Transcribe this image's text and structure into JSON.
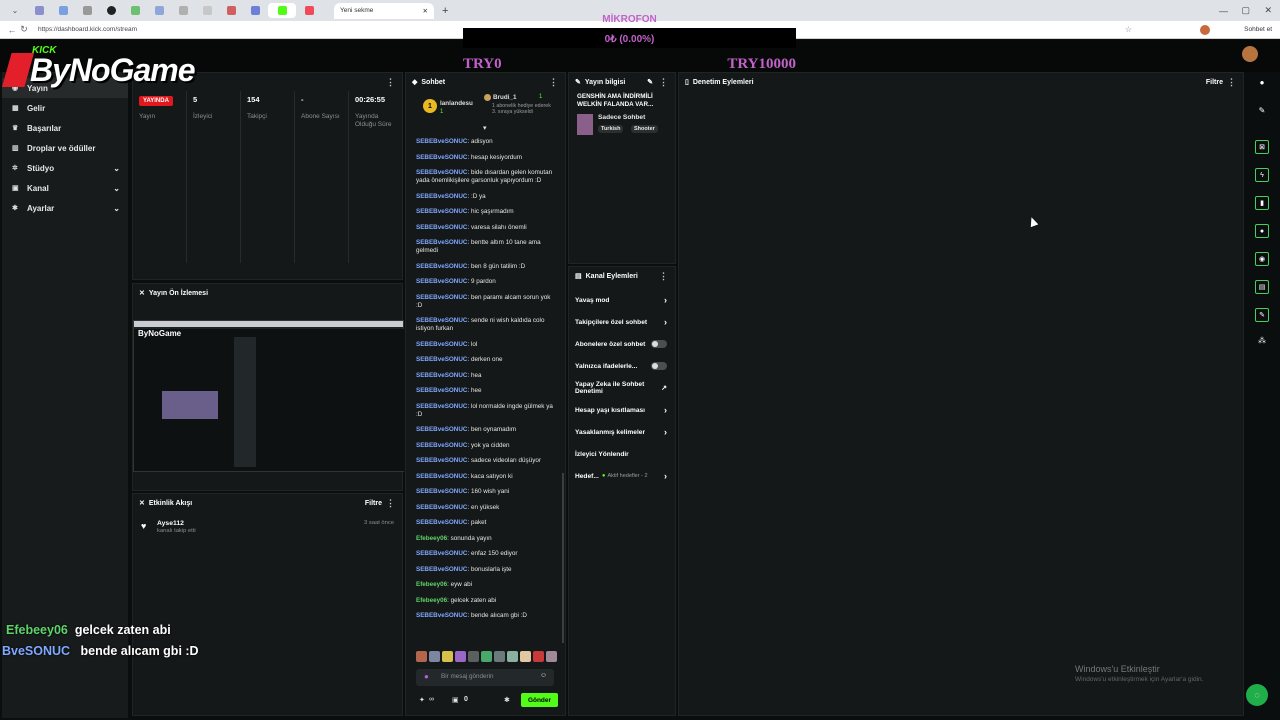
{
  "browser": {
    "newtab_label": "Yeni sekme",
    "url": "https://dashboard.kick.com/stream",
    "profile_btn": "Sohbet et"
  },
  "overlay": {
    "logo": "ByNoGame",
    "kick_tag": "KICK",
    "mic_label": "MİKROFON",
    "mic_value": "0₺ (0.00%)",
    "goal_min": "TRY0",
    "goal_max": "TRY10000",
    "chat": [
      {
        "user": "Efebeey06",
        "msg": "gelcek zaten abi"
      },
      {
        "user": "BveSONUC",
        "msg": "bende alıcam gbi :D"
      }
    ]
  },
  "sidebar": {
    "items": [
      {
        "label": "Yayın",
        "icon": "broadcast-icon"
      },
      {
        "label": "Gelir",
        "icon": "income-icon"
      },
      {
        "label": "Başarılar",
        "icon": "trophy-icon"
      },
      {
        "label": "Droplar ve ödüller",
        "icon": "gift-icon"
      },
      {
        "label": "Stüdyo",
        "icon": "studio-icon"
      },
      {
        "label": "Kanal",
        "icon": "channel-icon"
      },
      {
        "label": "Ayarlar",
        "icon": "gear-icon"
      }
    ]
  },
  "stream_stats": {
    "badge": "YAYINDA",
    "status_label": "Yayın",
    "viewers": "5",
    "viewers_label": "İzleyici",
    "followers": "154",
    "followers_label": "Takipçi",
    "subs": "-",
    "subs_label": "Abone Sayısı",
    "uptime": "00:26:55",
    "uptime_label": "Yayında Olduğu Süre"
  },
  "preview": {
    "title": "Yayın Ön İzlemesi"
  },
  "activity": {
    "title": "Etkinlik Akışı",
    "filter": "Filtre",
    "event_user": "Ayse112",
    "event_desc": "kanalı takip etti",
    "event_time": "3 saat önce"
  },
  "chat": {
    "title": "Sohbet",
    "top1_name": "lanlandesu",
    "top1_count": "1",
    "top2_name": "Brudi_1",
    "top2_count": "1",
    "top2_desc": "1 abonelik hediye ederek 3. sıraya yükseldi",
    "messages": [
      {
        "u": "SEBEBveSONUC",
        "m": "adisyon"
      },
      {
        "u": "SEBEBveSONUC",
        "m": "hesap kesiyordum"
      },
      {
        "u": "SEBEBveSONUC",
        "m": "bide dısardan gelen komutan yada önemlikişilere garsonluk yapıyordum :D"
      },
      {
        "u": "SEBEBveSONUC",
        "m": ":D ya"
      },
      {
        "u": "SEBEBveSONUC",
        "m": "hic şaşırmadım"
      },
      {
        "u": "SEBEBveSONUC",
        "m": "varesa silahı önemli"
      },
      {
        "u": "SEBEBveSONUC",
        "m": "bentte altım 10 tane ama gelmedi"
      },
      {
        "u": "SEBEBveSONUC",
        "m": "ben 8 gün tatilim :D"
      },
      {
        "u": "SEBEBveSONUC",
        "m": "9 pardon"
      },
      {
        "u": "SEBEBveSONUC",
        "m": "ben paramı alcam sorun yok :D"
      },
      {
        "u": "SEBEBveSONUC",
        "m": "sende ni wish kaldıda colo istiyon furkan"
      },
      {
        "u": "SEBEBveSONUC",
        "m": "lol"
      },
      {
        "u": "SEBEBveSONUC",
        "m": "derken one"
      },
      {
        "u": "SEBEBveSONUC",
        "m": "hea"
      },
      {
        "u": "SEBEBveSONUC",
        "m": "hee"
      },
      {
        "u": "SEBEBveSONUC",
        "m": "lol normalde ingde gülmek ya :D"
      },
      {
        "u": "SEBEBveSONUC",
        "m": "ben oynamadım"
      },
      {
        "u": "SEBEBveSONUC",
        "m": "yok ya cidden"
      },
      {
        "u": "SEBEBveSONUC",
        "m": "sadece videoları düşüyor"
      },
      {
        "u": "SEBEBveSONUC",
        "m": "kaca satıyon ki"
      },
      {
        "u": "SEBEBveSONUC",
        "m": "160 wish yani"
      },
      {
        "u": "SEBEBveSONUC",
        "m": "en yüksek"
      },
      {
        "u": "SEBEBveSONUC",
        "m": "paket"
      },
      {
        "u": "Efebeey06",
        "m": "sonunda yayın"
      },
      {
        "u": "SEBEBveSONUC",
        "m": "enfaz 150 ediyor"
      },
      {
        "u": "SEBEBveSONUC",
        "m": "bonuslarla işte"
      },
      {
        "u": "Efebeey06",
        "m": "eyw abi"
      },
      {
        "u": "Efebeey06",
        "m": "gelcek zaten abi"
      },
      {
        "u": "SEBEBveSONUC",
        "m": "bende alıcam gbi :D"
      }
    ],
    "placeholder": "Bir mesaj gönderin",
    "points": "∞",
    "gifts": "0",
    "send": "Gönder"
  },
  "stream_info": {
    "title": "Yayın bilgisi",
    "stream_title": "GENSHİN AMA İNDİRMİLİ WELKİN FALANDA VAR...",
    "chat_mode": "Sadece Sohbet",
    "tag1": "Turkish",
    "tag2": "Shooter"
  },
  "channel_actions": {
    "title": "Kanal Eylemleri",
    "rows": [
      "Yavaş mod",
      "Takipçilere özel sohbet",
      "Abonelere özel sohbet",
      "Yalnızca ifadelerle...",
      "Yapay Zeka ile Sohbet Denetimi",
      "Hesap yaşı kısıtlaması",
      "Yasaklanmış kelimeler",
      "İzleyici Yönlendir",
      "Hedef..."
    ],
    "goal_note": "Aktif hedefler - 2"
  },
  "moderation": {
    "title": "Denetim Eylemleri",
    "filter": "Filtre"
  },
  "watermark": {
    "line1": "Windows'u Etkinleştir",
    "line2": "Windows'u etkinleştirmek için Ayarlar'a gidin."
  },
  "colors": {
    "accent": "#53fc18",
    "live": "#e0191e",
    "user_blue": "#7fa8ff",
    "user_green": "#5fd36b"
  }
}
